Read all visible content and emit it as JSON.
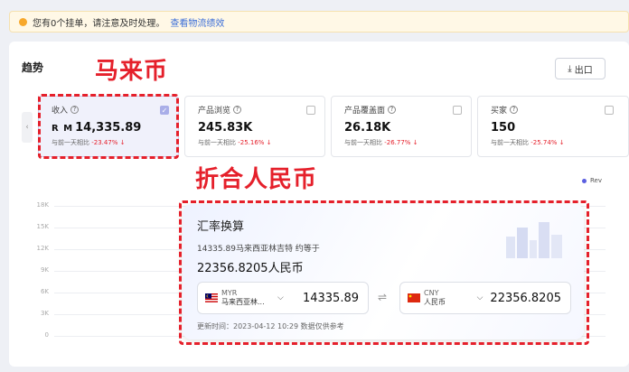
{
  "notice": {
    "text": "您有0个挂单，请注意及时处理。",
    "link": "查看物流绩效"
  },
  "trend": {
    "title": "趋势",
    "export_label": "出口"
  },
  "annotations": {
    "currency": "马来币",
    "converted": "折合人民币"
  },
  "metrics": [
    {
      "label": "收入",
      "currency": "R M",
      "value": "14,335.89",
      "compare": "与前一天相比",
      "change": "-23.47%"
    },
    {
      "label": "产品浏览",
      "currency": "",
      "value": "245.83K",
      "compare": "与前一天相比",
      "change": "-25.16%"
    },
    {
      "label": "产品覆盖面",
      "currency": "",
      "value": "26.18K",
      "compare": "与前一天相比",
      "change": "-26.77%"
    },
    {
      "label": "买家",
      "currency": "",
      "value": "150",
      "compare": "与前一天相比",
      "change": "-25.74%"
    }
  ],
  "legend": {
    "label": "Rev"
  },
  "chart_yticks": [
    "18K",
    "15K",
    "12K",
    "9K",
    "6K",
    "3K",
    "0"
  ],
  "fx": {
    "title": "汇率换算",
    "description": "14335.89马来西亚林吉特 约等于",
    "result": "22356.8205人民币",
    "from": {
      "code": "MYR",
      "name": "马来西亚林...",
      "amount": "14335.89"
    },
    "to": {
      "code": "CNY",
      "name": "人民币",
      "amount": "22356.8205"
    },
    "swap_icon": "⇌",
    "update": "更新时间：2023-04-12 10:29 数据仅供参考"
  },
  "colors": {
    "accent": "#5b5fe0",
    "annotation": "#e5202b",
    "negative": "#e5202b",
    "link": "#3d6fd8"
  }
}
